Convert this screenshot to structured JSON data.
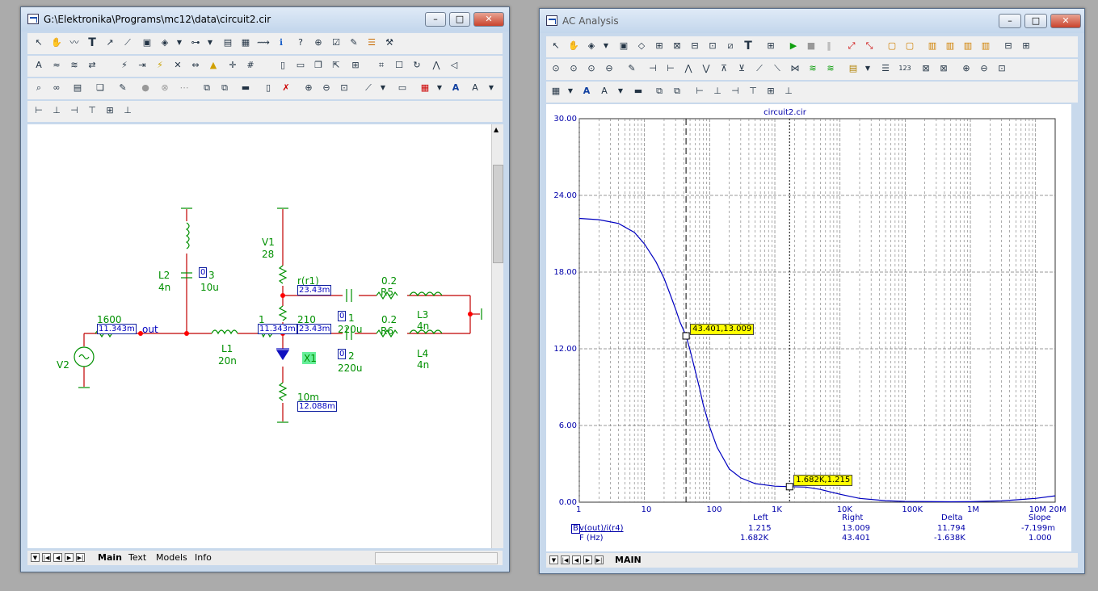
{
  "schematic_window": {
    "title": "G:\\Elektronika\\Programs\\mc12\\data\\circuit2.cir",
    "tabs": [
      "Main",
      "Text",
      "Models",
      "Info"
    ],
    "components": {
      "l2_name": "L2",
      "l2_value": "4n",
      "c3_label": "0",
      "c3_suffix": "3",
      "c3_value": "10u",
      "v1_name": "V1",
      "v1_value": "28",
      "r1_name": "r(r1)",
      "r1_current": "23.43m",
      "v2_name": "V2",
      "r_in_value": "1600",
      "r_in_current": "11.343m",
      "out_label": "out",
      "l1_name": "L1",
      "l1_value": "20n",
      "r_mid_value": "1",
      "r_mid_current": "11.343m",
      "r_top_value": "210",
      "r_top_current": "23.43m",
      "x1_name": "X1",
      "r_bot_value": "10m",
      "r_bot_current": "12.088m",
      "c1_label": "0",
      "c1_suffix": "1",
      "c1_value": "220u",
      "c2_label": "0",
      "c2_suffix": "2",
      "c2_value": "220u",
      "r5_value": "0.2",
      "r5_name": "R5",
      "r6_value": "0.2",
      "r6_name": "R6",
      "l3_name": "L3",
      "l3_value": "4n",
      "l4_name": "L4",
      "l4_value": "4n"
    }
  },
  "analysis_window": {
    "title": "AC Analysis",
    "tab": "MAIN",
    "colors": {
      "curve": "#0000c0",
      "grid": "#777777",
      "tooltip": "#ffff00"
    },
    "chart_data": {
      "type": "line",
      "title": "circuit2.cir",
      "x_scale": "log",
      "xlim": [
        1,
        20000000
      ],
      "ylim": [
        0,
        30
      ],
      "x_ticks": [
        "1",
        "10",
        "100",
        "1K",
        "10K",
        "100K",
        "1M",
        "10M 20M"
      ],
      "y_ticks": [
        "0.00",
        "6.00",
        "12.00",
        "18.00",
        "24.00",
        "30.00"
      ],
      "grid": true,
      "series": [
        {
          "name": "v(out)/i(r4)",
          "x": [
            1,
            2,
            4,
            7,
            10,
            15,
            20,
            25,
            30,
            35,
            43.4,
            50,
            60,
            70,
            80,
            100,
            130,
            200,
            300,
            500,
            1000,
            1682,
            3000,
            5000,
            10000,
            20000,
            50000,
            100000,
            500000,
            1000000,
            3000000,
            10000000,
            20000000
          ],
          "y": [
            22.2,
            22.1,
            21.8,
            21.1,
            20.2,
            18.8,
            17.5,
            16.2,
            15.1,
            14.1,
            13.009,
            11.9,
            10.3,
            8.9,
            7.6,
            5.9,
            4.3,
            2.6,
            1.9,
            1.45,
            1.25,
            1.215,
            1.18,
            1.0,
            0.62,
            0.3,
            0.12,
            0.06,
            0.03,
            0.04,
            0.1,
            0.3,
            0.5
          ]
        }
      ],
      "cursors": [
        {
          "x": 43.401,
          "y": 13.009,
          "label": "43.401,13.009"
        },
        {
          "x": 1682,
          "y": 1.215,
          "label": "1.682K,1.215"
        }
      ]
    },
    "readout": {
      "headers": [
        "Left",
        "Right",
        "Delta",
        "Slope"
      ],
      "rows": [
        {
          "label": "v(out)/i(r4)",
          "prefix": "B",
          "values": [
            "1.215",
            "13.009",
            "11.794",
            "-7.199m"
          ]
        },
        {
          "label": "F (Hz)",
          "prefix": "",
          "values": [
            "1.682K",
            "43.401",
            "-1.638K",
            "1.000"
          ]
        }
      ]
    }
  }
}
